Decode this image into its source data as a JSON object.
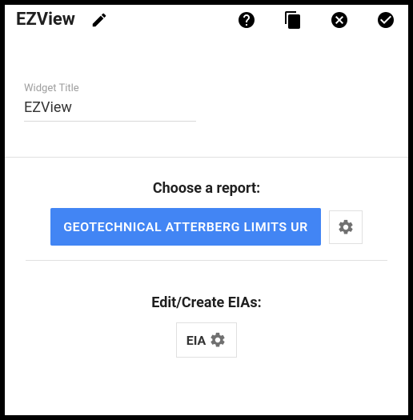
{
  "header": {
    "title": "EZView"
  },
  "widget": {
    "title_label": "Widget Title",
    "title_value": "EZView"
  },
  "report": {
    "heading": "Choose a report:",
    "selected": "GEOTECHNICAL ATTERBERG LIMITS UR"
  },
  "eia": {
    "heading": "Edit/Create EIAs:",
    "button_label": "EIA"
  },
  "icons": {
    "edit": "edit-icon",
    "help": "help-icon",
    "copy": "copy-icon",
    "cancel": "cancel-icon",
    "ok": "ok-icon",
    "gear": "gear-icon"
  },
  "colors": {
    "primary": "#4285f4"
  }
}
